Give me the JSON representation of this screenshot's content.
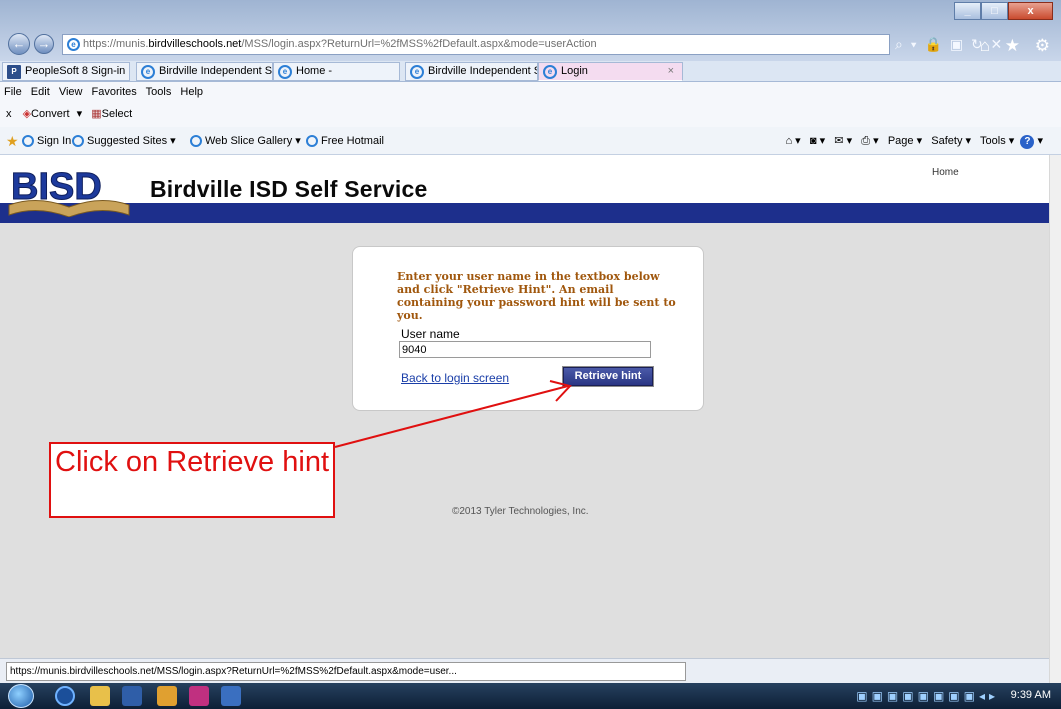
{
  "browser": {
    "address_prefix": "https://munis.",
    "address_domain": "birdvilleschools.net",
    "address_suffix": "/MSS/login.aspx?ReturnUrl=%2fMSS%2fDefault.aspx&mode=userAction",
    "address_right_icons": "⌕ ▾ 🔒 ▣ ↻ ✕",
    "toolbar_icons": "⌂ ★ ⚙",
    "tabs": [
      {
        "label": "PeopleSoft 8 Sign-in"
      },
      {
        "label": "Birdville Independent S..."
      },
      {
        "label": "Home -"
      },
      {
        "label": "Birdville Independent S..."
      },
      {
        "label": "Login"
      }
    ],
    "menu": [
      "File",
      "Edit",
      "View",
      "Favorites",
      "Tools",
      "Help"
    ],
    "commands": {
      "close_glyph": "x",
      "convert": "Convert",
      "select": "Select"
    },
    "favorites": [
      {
        "label": "Sign In"
      },
      {
        "label": "Suggested Sites ▾"
      },
      {
        "label": "Web Slice Gallery ▾"
      },
      {
        "label": "Free Hotmail"
      }
    ],
    "cmd_right": {
      "page": "Page ▾",
      "safety": "Safety ▾",
      "tools": "Tools ▾"
    },
    "status_url": "https://munis.birdvilleschools.net/MSS/login.aspx?ReturnUrl=%2fMSS%2fDefault.aspx&mode=user..."
  },
  "site": {
    "logo_text": "BISD",
    "title": "Birdville ISD Self Service",
    "home_link": "Home",
    "navy_color": "#1d2f8c"
  },
  "form": {
    "instructions": "Enter your user name in the textbox below and click \"Retrieve Hint\". An email containing your password hint will be sent to you.",
    "username_label": "User name",
    "username_value": "9040",
    "back_link": "Back to login screen",
    "retrieve_button": "Retrieve hint"
  },
  "footer": {
    "copyright": "©2013 Tyler Technologies, Inc."
  },
  "annotation": {
    "callout_text": "Click on Retrieve hint",
    "color": "#e01010"
  },
  "taskbar": {
    "clock": "9:39 AM"
  }
}
